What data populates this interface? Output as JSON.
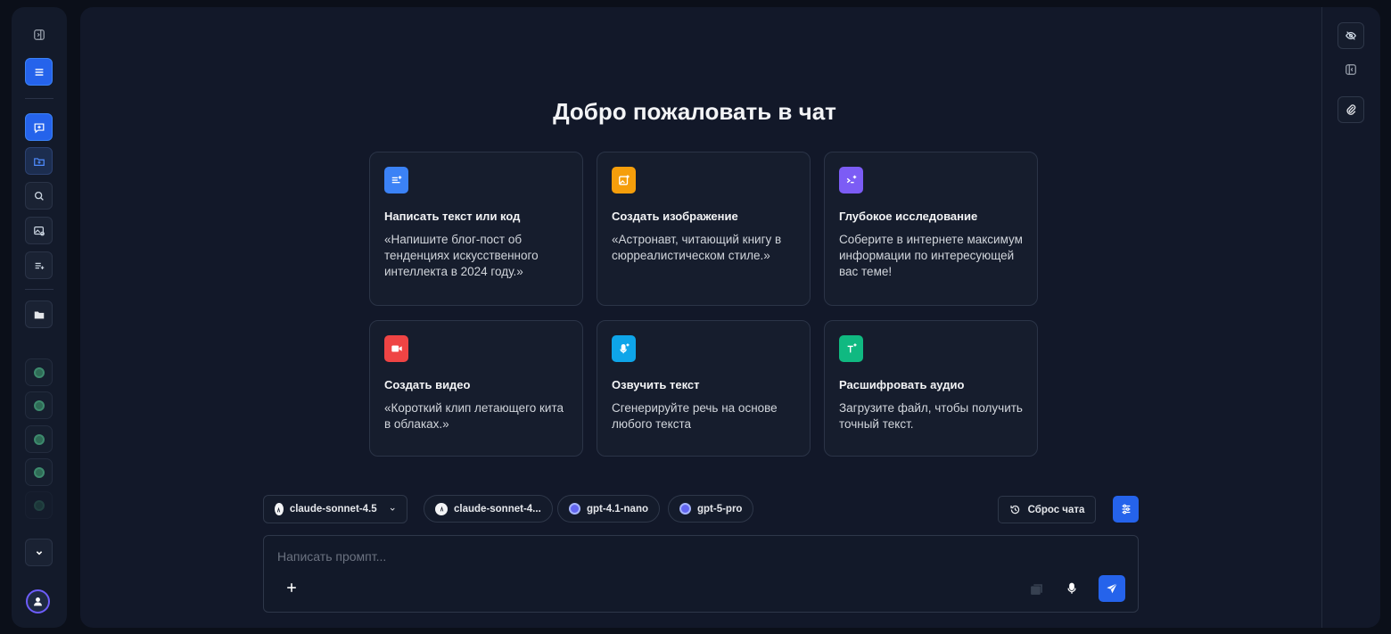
{
  "sidebar": {
    "items": [
      "toggle-sidebar",
      "menu",
      "new-chat",
      "new-folder",
      "search",
      "gallery",
      "prompts",
      "folder"
    ]
  },
  "main": {
    "title": "Добро пожаловать в чат"
  },
  "cards": [
    {
      "title": "Написать текст или код",
      "desc": "«Напишите блог-пост об тенденциях искусственного интеллекта в 2024 году.»",
      "color": "#3b82f6",
      "icon": "text-sparkle-icon"
    },
    {
      "title": "Создать изображение",
      "desc": "«Астронавт, читающий книгу в сюрреалистическом стиле.»",
      "color": "#f59e0b",
      "icon": "image-sparkle-icon"
    },
    {
      "title": "Глубокое исследование",
      "desc": "Соберите в интернете максимум информации по интересующей вас теме!",
      "color": "#7c5cf5",
      "icon": "terminal-sparkle-icon"
    },
    {
      "title": "Создать видео",
      "desc": "«Короткий клип летающего кита в облаках.»",
      "color": "#ef4444",
      "icon": "video-camera-icon"
    },
    {
      "title": "Озвучить текст",
      "desc": "Сгенерируйте речь на основе любого текста",
      "color": "#0ea5e9",
      "icon": "microphone-sparkle-icon"
    },
    {
      "title": "Расшифровать аудио",
      "desc": "Загрузите файл, чтобы получить точный текст.",
      "color": "#10b981",
      "icon": "text-t-icon"
    }
  ],
  "models": {
    "selected": "claude-sonnet-4.5",
    "chips": [
      "claude-sonnet-4...",
      "gpt-4.1-nano",
      "gpt-5-pro"
    ]
  },
  "toolbar": {
    "reset_label": "Сброс чата"
  },
  "prompt": {
    "placeholder": "Написать промпт..."
  },
  "colors": {
    "accent": "#2563eb",
    "background": "#0b0f19",
    "panel": "#121829"
  }
}
